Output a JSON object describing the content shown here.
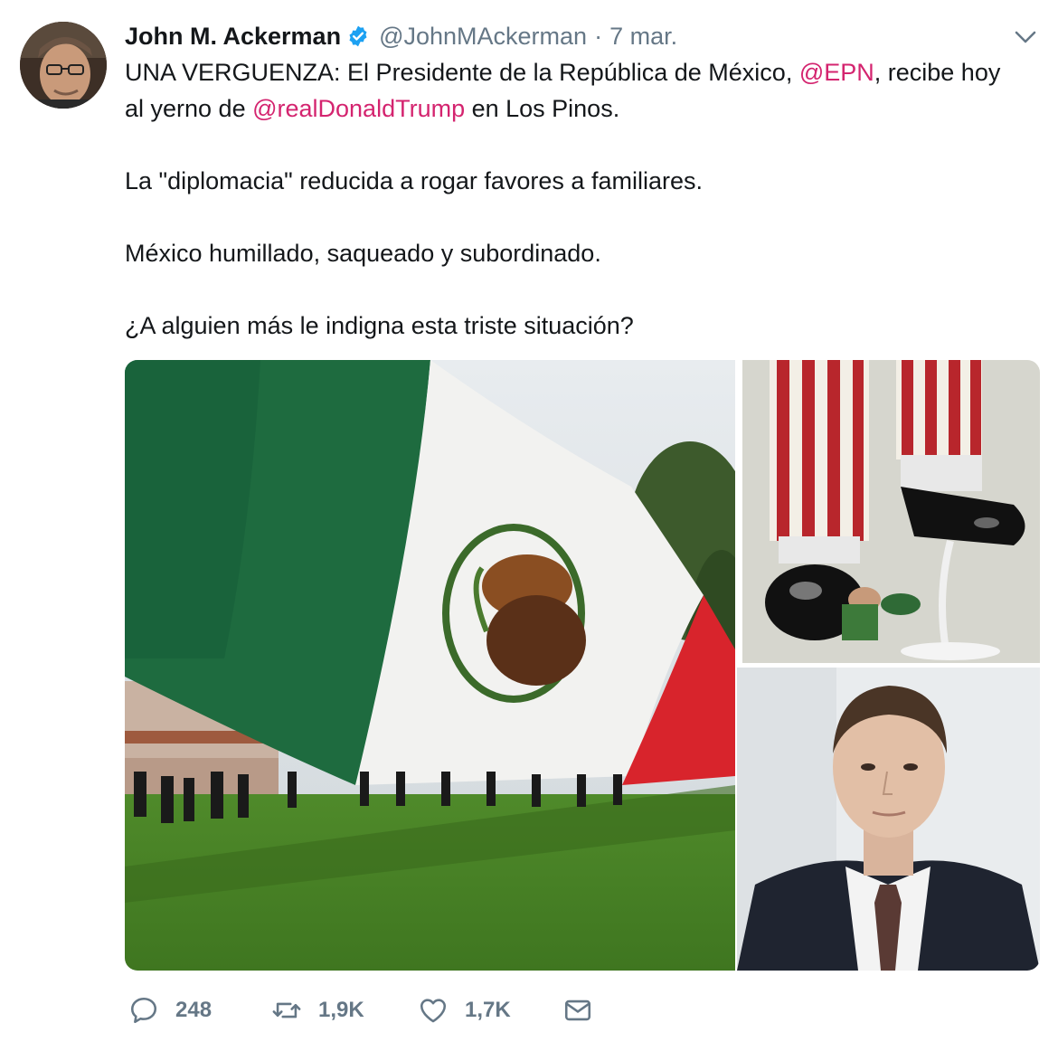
{
  "tweet": {
    "author_name": "John M. Ackerman",
    "handle": "@JohnMAckerman",
    "separator": "·",
    "timestamp": "7 mar.",
    "text": {
      "line1_pre": "UNA VERGUENZA: El Presidente de la República de México, ",
      "mention1": "@EPN",
      "line1_post": ", recibe hoy",
      "line2_pre": "al yerno de ",
      "mention2": "@realDonaldTrump",
      "line2_post": " en Los Pinos.",
      "para2": "La \"diplomacia\" reducida a rogar favores a familiares.",
      "para3": "México humillado, saqueado y subordinado.",
      "para4": "¿A alguien más le indigna esta triste situación?"
    },
    "media": [
      {
        "icon": "mexican-flag-photo"
      },
      {
        "icon": "striped-pants-cartoon"
      },
      {
        "icon": "man-portrait-photo"
      }
    ],
    "actions": {
      "reply_count": "248",
      "retweet_count": "1,9K",
      "like_count": "1,7K"
    }
  },
  "colors": {
    "mention": "#d4246f",
    "secondary": "#657786",
    "verified": "#1da1f2"
  }
}
